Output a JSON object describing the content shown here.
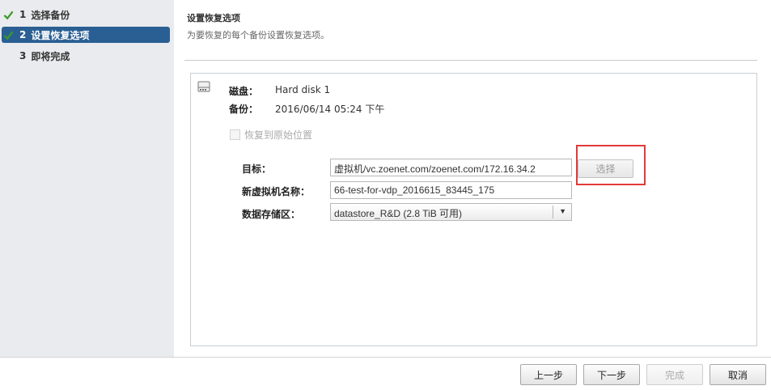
{
  "steps": [
    {
      "num": "1",
      "label": "选择备份",
      "done": true
    },
    {
      "num": "2",
      "label": "设置恢复选项",
      "done": true,
      "active": true
    },
    {
      "num": "3",
      "label": "即将完成",
      "done": false
    }
  ],
  "header": {
    "title": "设置恢复选项",
    "subtitle": "为要恢复的每个备份设置恢复选项。"
  },
  "disk": {
    "disk_label": "磁盘：",
    "disk_value": "Hard disk 1",
    "backup_label": "备份：",
    "backup_value": "2016/06/14 05:24 下午",
    "restore_original_label": "恢复到原始位置",
    "target_label": "目标：",
    "target_value": "虚拟机/vc.zoenet.com/zoenet.com/172.16.34.2",
    "choose_label": "选择",
    "vm_name_label": "新虚拟机名称：",
    "vm_name_value": "66-test-for-vdp_2016615_83445_175",
    "datastore_label": "数据存储区：",
    "datastore_value": "datastore_R&D (2.8 TiB 可用)"
  },
  "footer": {
    "prev": "上一步",
    "next": "下一步",
    "finish": "完成",
    "cancel": "取消"
  },
  "colors": {
    "accent": "#2a5f93",
    "check": "#3a9a2a",
    "highlight": "#e23a3a"
  }
}
